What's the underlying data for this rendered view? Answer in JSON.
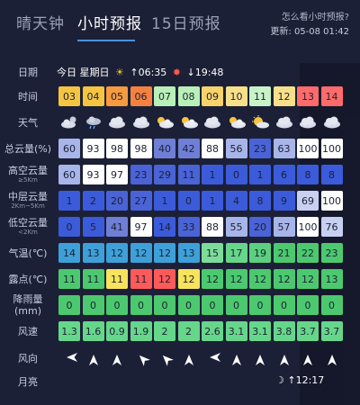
{
  "tabs": [
    "晴天钟",
    "小时预报",
    "15日预报"
  ],
  "active_tab": 1,
  "help_link": "怎么看小时预报?",
  "updated": "更新:  05-08 01:42",
  "row_labels": {
    "date": "日期",
    "time": "时间",
    "weather": "天气",
    "total_cloud": "总云量(%)",
    "high_cloud": "高空云量",
    "high_cloud_sub": "≥5Km",
    "mid_cloud": "中层云量",
    "mid_cloud_sub": "2Km~5Km",
    "low_cloud": "低空云量",
    "low_cloud_sub": "<2Km",
    "temp": "气温(℃)",
    "dew": "露点(℃)",
    "rain": "降雨量(mm)",
    "wind_speed": "风速",
    "wind_dir": "风向",
    "moon": "月亮"
  },
  "date_info": {
    "day": "今日 星期日",
    "sun_icon": "sunrise-icon",
    "sunrise": "↑06:35",
    "sunset_icon": "sunset-icon",
    "sunset": "↓19:48"
  },
  "moonrise": "↑12:17",
  "hours": [
    "03",
    "04",
    "05",
    "06",
    "07",
    "08",
    "09",
    "10",
    "11",
    "12",
    "13",
    "14"
  ],
  "weather_icons": [
    "cloudy-night",
    "rain-cloud",
    "cloudy",
    "cloudy",
    "partly-cloudy",
    "partly-cloudy",
    "cloudy",
    "partly-cloudy",
    "sunny-cloud",
    "cloudy",
    "cloudy",
    "cloudy"
  ],
  "total_cloud": [
    "60",
    "93",
    "98",
    "98",
    "40",
    "42",
    "88",
    "56",
    "23",
    "63",
    "100",
    "100"
  ],
  "high_cloud": [
    "60",
    "93",
    "97",
    "23",
    "29",
    "11",
    "1",
    "0",
    "1",
    "6",
    "8",
    "8"
  ],
  "mid_cloud": [
    "1",
    "2",
    "20",
    "27",
    "1",
    "0",
    "1",
    "4",
    "8",
    "9",
    "69",
    "100"
  ],
  "low_cloud": [
    "0",
    "5",
    "41",
    "97",
    "14",
    "33",
    "88",
    "55",
    "20",
    "57",
    "100",
    "76"
  ],
  "temp": [
    "14",
    "13",
    "12",
    "12",
    "12",
    "13",
    "15",
    "17",
    "19",
    "21",
    "22",
    "23"
  ],
  "dew": [
    "11",
    "11",
    "11",
    "11",
    "12",
    "12",
    "12",
    "12",
    "12",
    "12",
    "12",
    "13"
  ],
  "rain": [
    "0",
    "0",
    "0",
    "0",
    "0",
    "0",
    "0",
    "0",
    "0",
    "0",
    "0",
    "0"
  ],
  "wind_speed": [
    "1.3",
    "1.6",
    "0.9",
    "1.9",
    "2",
    "2",
    "2.6",
    "3.1",
    "3.1",
    "3.8",
    "3.7",
    "3.7"
  ],
  "wind_dir": [
    "west-arrow",
    "north-arrow",
    "north-arrow",
    "northwest-arrow",
    "northwest-arrow",
    "north-arrow",
    "west-arrow",
    "north-arrow",
    "north-arrow",
    "north-arrow",
    "north-arrow",
    "north-arrow"
  ],
  "colors": {
    "time": [
      "#f5c542",
      "#f5c542",
      "#f59a3f",
      "#f5813f",
      "#b8f0b8",
      "#b8f0b8",
      "#f7d36b",
      "#f7e08a",
      "#c8f2c8",
      "#f7e08a",
      "#ff6b6b",
      "#ff6b6b"
    ],
    "total_cloud": [
      "#a8b5e8",
      "#ffffff",
      "#ffffff",
      "#ffffff",
      "#6f7fd6",
      "#6f7fd6",
      "#ffffff",
      "#a8b5e8",
      "#4a63d6",
      "#a8b5e8",
      "#ffffff",
      "#ffffff"
    ],
    "high_cloud": [
      "#a8b5e8",
      "#ffffff",
      "#ffffff",
      "#4a63d6",
      "#4a63d6",
      "#4a63d6",
      "#3b5bdb",
      "#3b5bdb",
      "#3b5bdb",
      "#3b5bdb",
      "#3b5bdb",
      "#3b5bdb"
    ],
    "mid_cloud": [
      "#3b5bdb",
      "#3b5bdb",
      "#4a63d6",
      "#4a63d6",
      "#3b5bdb",
      "#3b5bdb",
      "#3b5bdb",
      "#3b5bdb",
      "#3b5bdb",
      "#3b5bdb",
      "#c8d0f2",
      "#ffffff"
    ],
    "low_cloud": [
      "#3b5bdb",
      "#3b5bdb",
      "#6f7fd6",
      "#ffffff",
      "#3b5bdb",
      "#4a63d6",
      "#ffffff",
      "#a8b5e8",
      "#4a63d6",
      "#a8b5e8",
      "#ffffff",
      "#c8d0f2"
    ],
    "temp": [
      "#3ea0d8",
      "#3ea0d8",
      "#3ea0d8",
      "#3ea0d8",
      "#3ea0d8",
      "#3ea0d8",
      "#7ddc9a",
      "#66d68a",
      "#5cd07f",
      "#4cc96f",
      "#4cc96f",
      "#4cc96f"
    ],
    "dew": [
      "#4cc96f",
      "#4cc96f",
      "#f7e45c",
      "#ff5a5a",
      "#ff5a5a",
      "#f7e45c",
      "#4cc96f",
      "#4cc96f",
      "#4cc96f",
      "#4cc96f",
      "#4cc96f",
      "#4cc96f"
    ],
    "rain": [
      "#4cc96f",
      "#4cc96f",
      "#4cc96f",
      "#4cc96f",
      "#4cc96f",
      "#4cc96f",
      "#4cc96f",
      "#4cc96f",
      "#4cc96f",
      "#4cc96f",
      "#4cc96f",
      "#4cc96f"
    ],
    "wind_speed": [
      "#66d68a",
      "#66d68a",
      "#66d68a",
      "#66d68a",
      "#66d68a",
      "#66d68a",
      "#66d68a",
      "#66d68a",
      "#66d68a",
      "#66d68a",
      "#66d68a",
      "#66d68a"
    ],
    "accent": "#4a90e2",
    "background": "#1c2036"
  }
}
